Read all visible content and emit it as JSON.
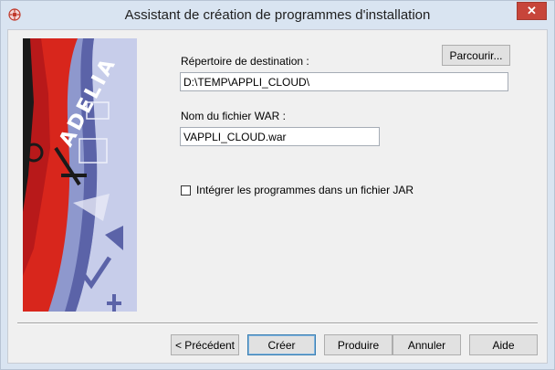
{
  "window": {
    "title": "Assistant de création de programmes d'installation",
    "close_label": "✕"
  },
  "banner": {
    "brand_text": "ADELIA",
    "colors": {
      "red": "#d8261c",
      "blue_light": "#c7cdea",
      "blue_mid": "#8e98cd",
      "blue_dark": "#5b63a8"
    }
  },
  "form": {
    "destination_label": "Répertoire de destination :",
    "destination_value": "D:\\TEMP\\APPLI_CLOUD\\",
    "browse_label": "Parcourir...",
    "war_label": "Nom du fichier WAR :",
    "war_value": "VAPPLI_CLOUD.war",
    "jar_checkbox_label": "Intégrer les programmes dans un fichier JAR",
    "jar_checked": false
  },
  "buttons": {
    "previous_label": "< Précédent",
    "create_label": "Créer",
    "produce_label": "Produire",
    "cancel_label": "Annuler",
    "help_label": "Aide"
  }
}
